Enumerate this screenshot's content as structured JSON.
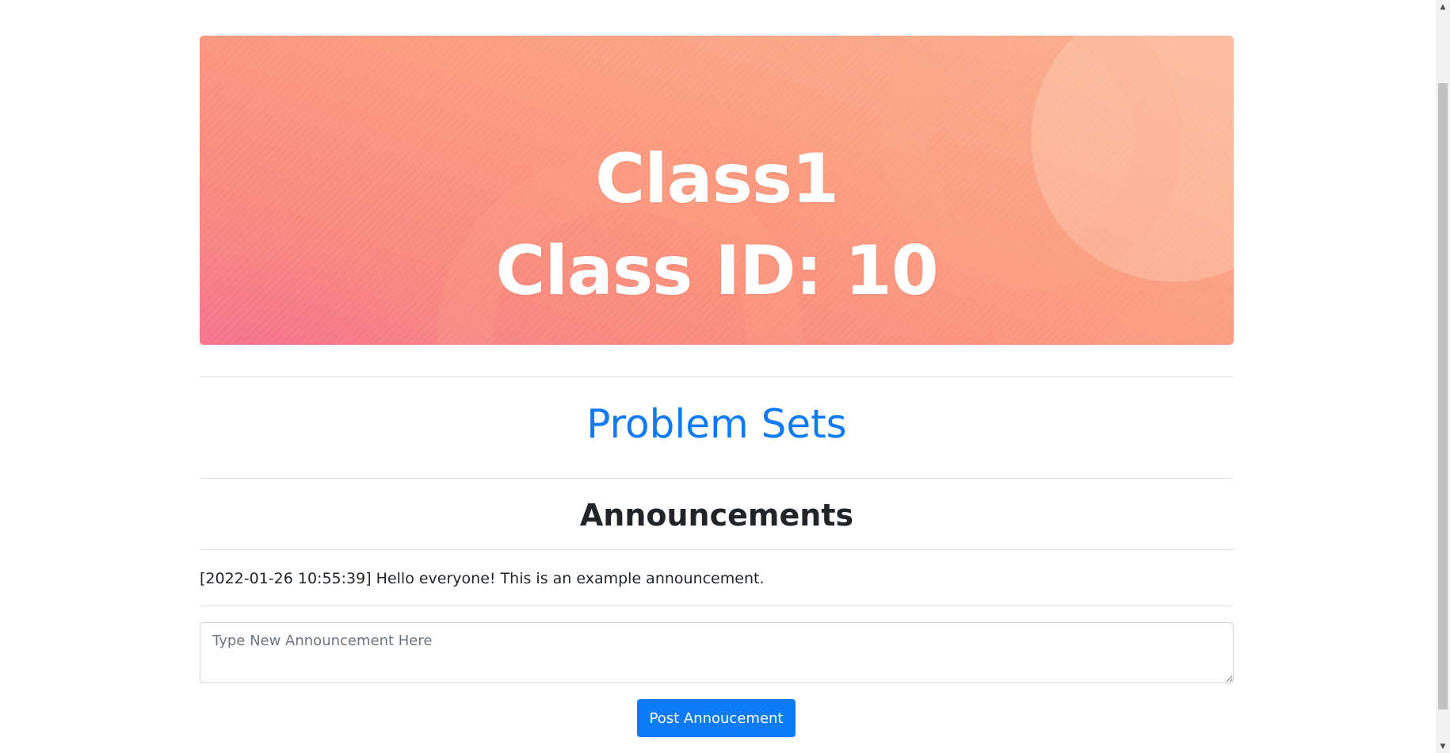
{
  "banner": {
    "class_name": "Class1",
    "class_id_line": "Class ID: 10"
  },
  "nav": {
    "problem_sets_label": "Problem Sets"
  },
  "announcements": {
    "heading": "Announcements",
    "items": [
      {
        "text": "[2022-01-26 10:55:39] Hello everyone! This is an example announcement."
      }
    ],
    "input_placeholder": "Type New Announcement Here",
    "input_value": "",
    "post_button_label": "Post Annoucement"
  },
  "scrollbar": {
    "up_icon": "▲",
    "down_icon": "▼"
  },
  "colors": {
    "link": "#0d7bf7",
    "button": "#0d7bf7",
    "banner_start": "#fbb090",
    "banner_end": "#f57a8e"
  }
}
